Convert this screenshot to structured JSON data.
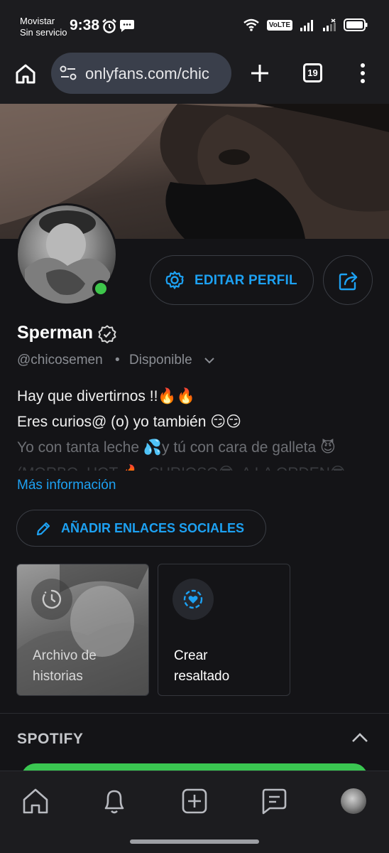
{
  "status_bar": {
    "carrier_line1": "Movistar",
    "carrier_line2": "Sin servicio",
    "time": "9:38",
    "volte_label": "VoLTE",
    "battery_level": 0.9
  },
  "browser": {
    "url": "onlyfans.com/chic",
    "tab_count": "19"
  },
  "profile": {
    "display_name": "Sperman",
    "handle": "@chicosemen",
    "separator": "•",
    "availability": "Disponible",
    "online": true,
    "edit_profile_label": "EDITAR PERFIL",
    "bio_lines": [
      "Hay que divertirnos !!🔥🔥",
      "Eres curios@ (o) yo también 😏😏",
      "Yo con tanta leche 💦y tú con cara de galleta 😈",
      "(MORBO, HOT 🔥, CURIOSO😎, A LA ORDEN😎"
    ],
    "more_info_label": "Más información",
    "add_social_label": "AÑADIR ENLACES SOCIALES"
  },
  "highlights": {
    "archive_label_line1": "Archivo de",
    "archive_label_line2": "historias",
    "create_label_line1": "Crear",
    "create_label_line2": "resaltado"
  },
  "spotify": {
    "title": "SPOTIFY"
  },
  "colors": {
    "accent": "#1da1f2",
    "online": "#3ec64b",
    "spotify_green": "#3ac651",
    "background": "#141417"
  },
  "icons": {
    "home": "home-icon",
    "notifications": "bell-icon",
    "add_post": "plus-square-icon",
    "messages": "chat-icon",
    "edit": "gear-icon",
    "share": "share-icon"
  }
}
